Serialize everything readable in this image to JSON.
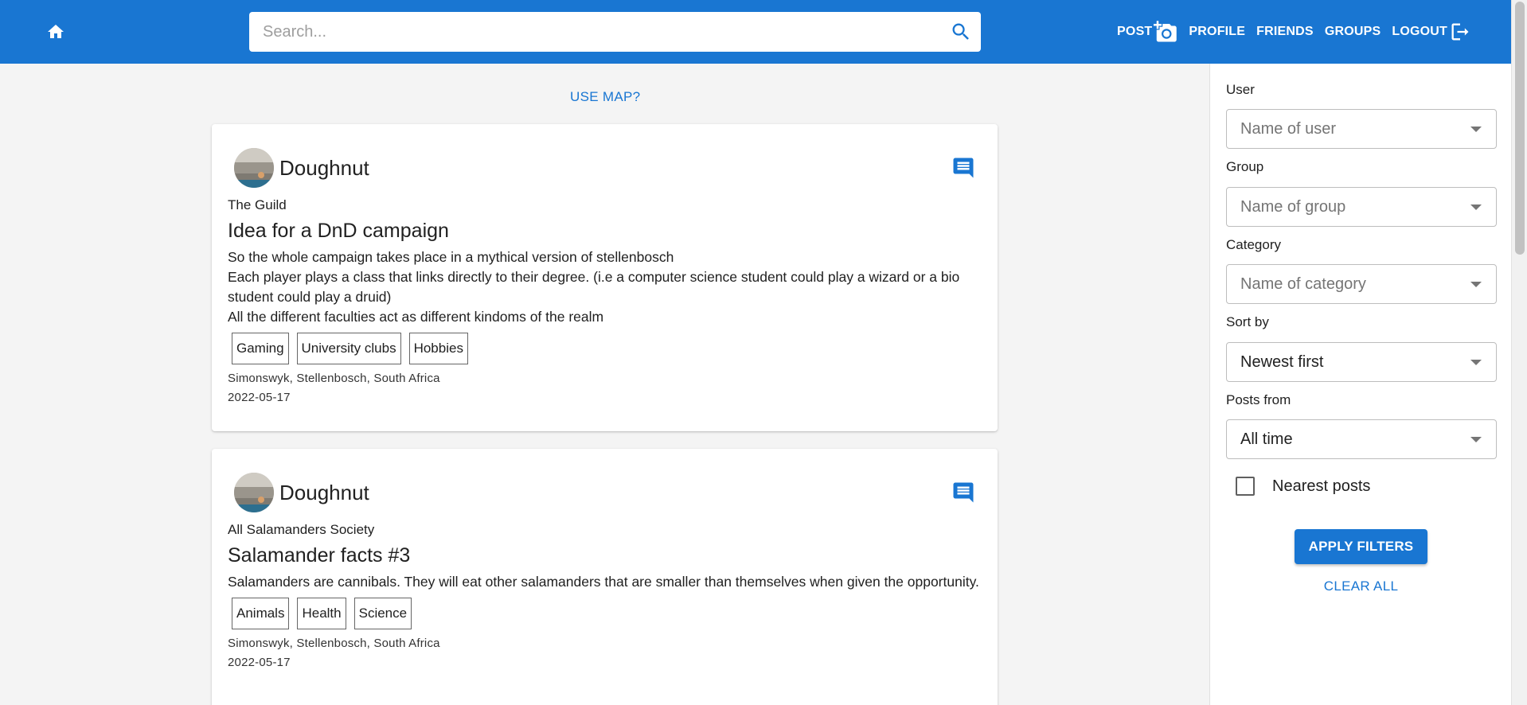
{
  "header": {
    "search_placeholder": "Search...",
    "nav": {
      "post": "POST",
      "profile": "PROFILE",
      "friends": "FRIENDS",
      "groups": "GROUPS",
      "logout": "LOGOUT"
    }
  },
  "feed": {
    "use_map": "USE MAP?",
    "posts": [
      {
        "user": "Doughnut",
        "group": "The Guild",
        "title": "Idea for a DnD campaign",
        "lines": [
          "So the whole campaign takes place in a mythical version of stellenbosch",
          "Each player plays a class that links directly to their degree. (i.e a computer science student could play a wizard or a bio student could play a druid)",
          "All the different faculties act as different kindoms of the realm"
        ],
        "tags": [
          "Gaming",
          "University clubs",
          "Hobbies"
        ],
        "location": "Simonswyk, Stellenbosch, South Africa",
        "date": "2022-05-17"
      },
      {
        "user": "Doughnut",
        "group": "All Salamanders Society",
        "title": "Salamander facts #3",
        "lines": [
          "Salamanders are cannibals. They will eat other salamanders that are smaller than themselves when given the opportunity."
        ],
        "tags": [
          "Animals",
          "Health",
          "Science"
        ],
        "location": "Simonswyk, Stellenbosch, South Africa",
        "date": "2022-05-17"
      }
    ]
  },
  "filters": {
    "user_label": "User",
    "user_placeholder": "Name of user",
    "group_label": "Group",
    "group_placeholder": "Name of group",
    "category_label": "Category",
    "category_placeholder": "Name of category",
    "sort_label": "Sort by",
    "sort_value": "Newest first",
    "posts_from_label": "Posts from",
    "posts_from_value": "All time",
    "nearest_label": "Nearest posts",
    "apply": "APPLY FILTERS",
    "clear": "CLEAR ALL"
  },
  "colors": {
    "primary": "#1976d2",
    "background": "#f4f4f4"
  }
}
